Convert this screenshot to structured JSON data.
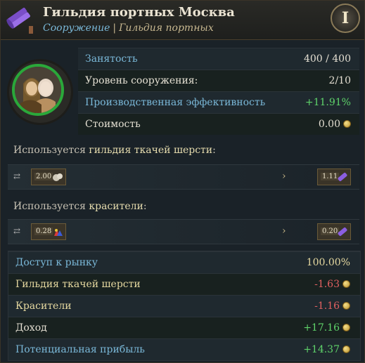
{
  "header": {
    "title": "Гильдия портных Москва",
    "subtitle_link": "Сооружение",
    "subtitle_sep": "|",
    "subtitle_name": "Гильдия портных",
    "info_label": "I"
  },
  "stats": [
    {
      "label": "Занятость",
      "value": "400 / 400",
      "label_color": "blue",
      "value_color": "white"
    },
    {
      "label": "Уровень сооружения:",
      "value": "2/10",
      "label_color": "white",
      "value_color": "white"
    },
    {
      "label": "Производственная эффективность",
      "value": "+11.91%",
      "label_color": "blue",
      "value_color": "green"
    },
    {
      "label": "Стоимость",
      "value": "0.00",
      "label_color": "white",
      "value_color": "white",
      "coin": true
    }
  ],
  "uses": [
    {
      "prefix": "Используется ",
      "good": "гильдия ткачей шерсти",
      "suffix": ":",
      "input_amount": "2.00",
      "output_amount": "1.11",
      "arrow": "›"
    },
    {
      "prefix": "Используется ",
      "good": "красители",
      "suffix": ":",
      "input_amount": "0.28",
      "output_amount": "0.20",
      "arrow": "›"
    }
  ],
  "market": [
    {
      "label": "Доступ к рынку",
      "value": "100.00%",
      "label_color": "blue",
      "value_color": "gold"
    },
    {
      "label": "Гильдия ткачей шерсти",
      "value": "-1.63",
      "label_color": "gold",
      "value_color": "red",
      "coin": true
    },
    {
      "label": "Красители",
      "value": "-1.16",
      "label_color": "gold",
      "value_color": "red",
      "coin": true
    },
    {
      "label": "Доход",
      "value": "+17.16",
      "label_color": "white",
      "value_color": "green",
      "coin": true
    },
    {
      "label": "Потенциальная прибыль",
      "value": "+14.37",
      "label_color": "blue",
      "value_color": "green",
      "coin": true
    }
  ],
  "colors": {
    "accent_blue": "#7ab8d8",
    "positive": "#5fd36a",
    "negative": "#e06060",
    "gold": "#e6d9a0",
    "portrait_ring": "#2aa83a"
  }
}
